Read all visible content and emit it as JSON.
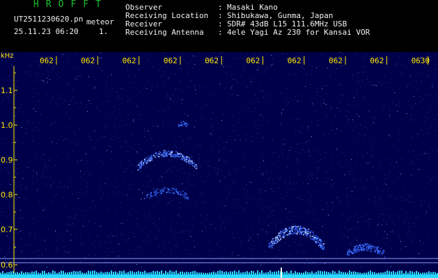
{
  "app": {
    "brand": "HROFFT",
    "filename": "UT2511230620.pn",
    "meteor_label": "meteor",
    "datetime": "25.11.23 06:20",
    "count": "1."
  },
  "info": {
    "labels": [
      "Observer",
      "Receiving Location",
      "Receiver",
      "Receiving Antenna"
    ],
    "colon": ":",
    "values": [
      "Masaki Kano",
      "Shibukawa, Gunma, Japan",
      "SDR# 43dB L15 111.6MHz USB",
      "4ele Yagi Az 230 for Kansai VOR"
    ]
  },
  "spectrogram": {
    "unit_label": "kHz",
    "y_ticks": [
      "1.1",
      "1.0",
      "0.9",
      "0.8",
      "0.7",
      "0.6"
    ],
    "time_ticks": [
      "062",
      "062",
      "062",
      "062",
      "062",
      "062",
      "062",
      "062",
      "062",
      "0630"
    ],
    "colors": {
      "background": "#00004a",
      "signal": "#3a6bff",
      "strong": "#b8d4ff",
      "tick": "#ffea00",
      "ref_line": "#8aa0ff",
      "noise_floor": "#29d9ff"
    }
  }
}
